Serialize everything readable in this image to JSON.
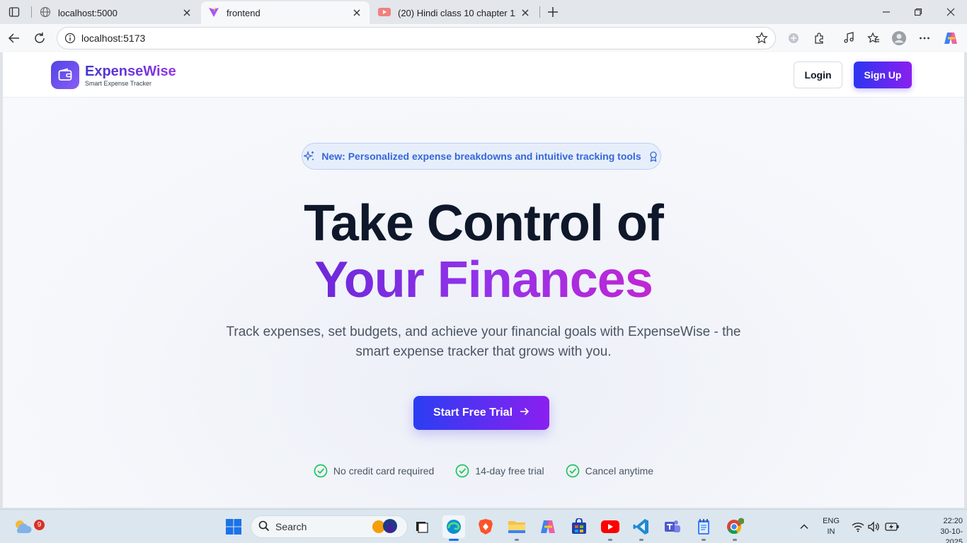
{
  "browser": {
    "tabs": [
      {
        "title": "localhost:5000",
        "active": false
      },
      {
        "title": "frontend",
        "active": true
      },
      {
        "title": "(20) Hindi class 10 chapter 11 bihar",
        "active": false
      }
    ],
    "url": "localhost:5173"
  },
  "header": {
    "brand_name": "ExpenseWise",
    "brand_tagline": "Smart Expense Tracker",
    "login_label": "Login",
    "signup_label": "Sign Up"
  },
  "hero": {
    "badge_text": "New: Personalized expense breakdowns and intuitive tracking tools",
    "headline_line1": "Take Control of",
    "headline_line2": "Your Finances",
    "subtitle": "Track expenses, set budgets, and achieve your financial goals with ExpenseWise - the smart expense tracker that grows with you.",
    "cta_label": "Start Free Trial",
    "features": [
      "No credit card required",
      "14-day free trial",
      "Cancel anytime"
    ]
  },
  "taskbar": {
    "search_label": "Search",
    "weather_badge": "9",
    "language_line1": "ENG",
    "language_line2": "IN",
    "time": "22:20",
    "date": "30-10-2025"
  },
  "colors": {
    "brand_gradient_start": "#2b3ef2",
    "brand_gradient_end": "#8b1ff0",
    "headline": "#0f172a",
    "badge_text": "#3467d8",
    "check_green": "#22c55e"
  }
}
